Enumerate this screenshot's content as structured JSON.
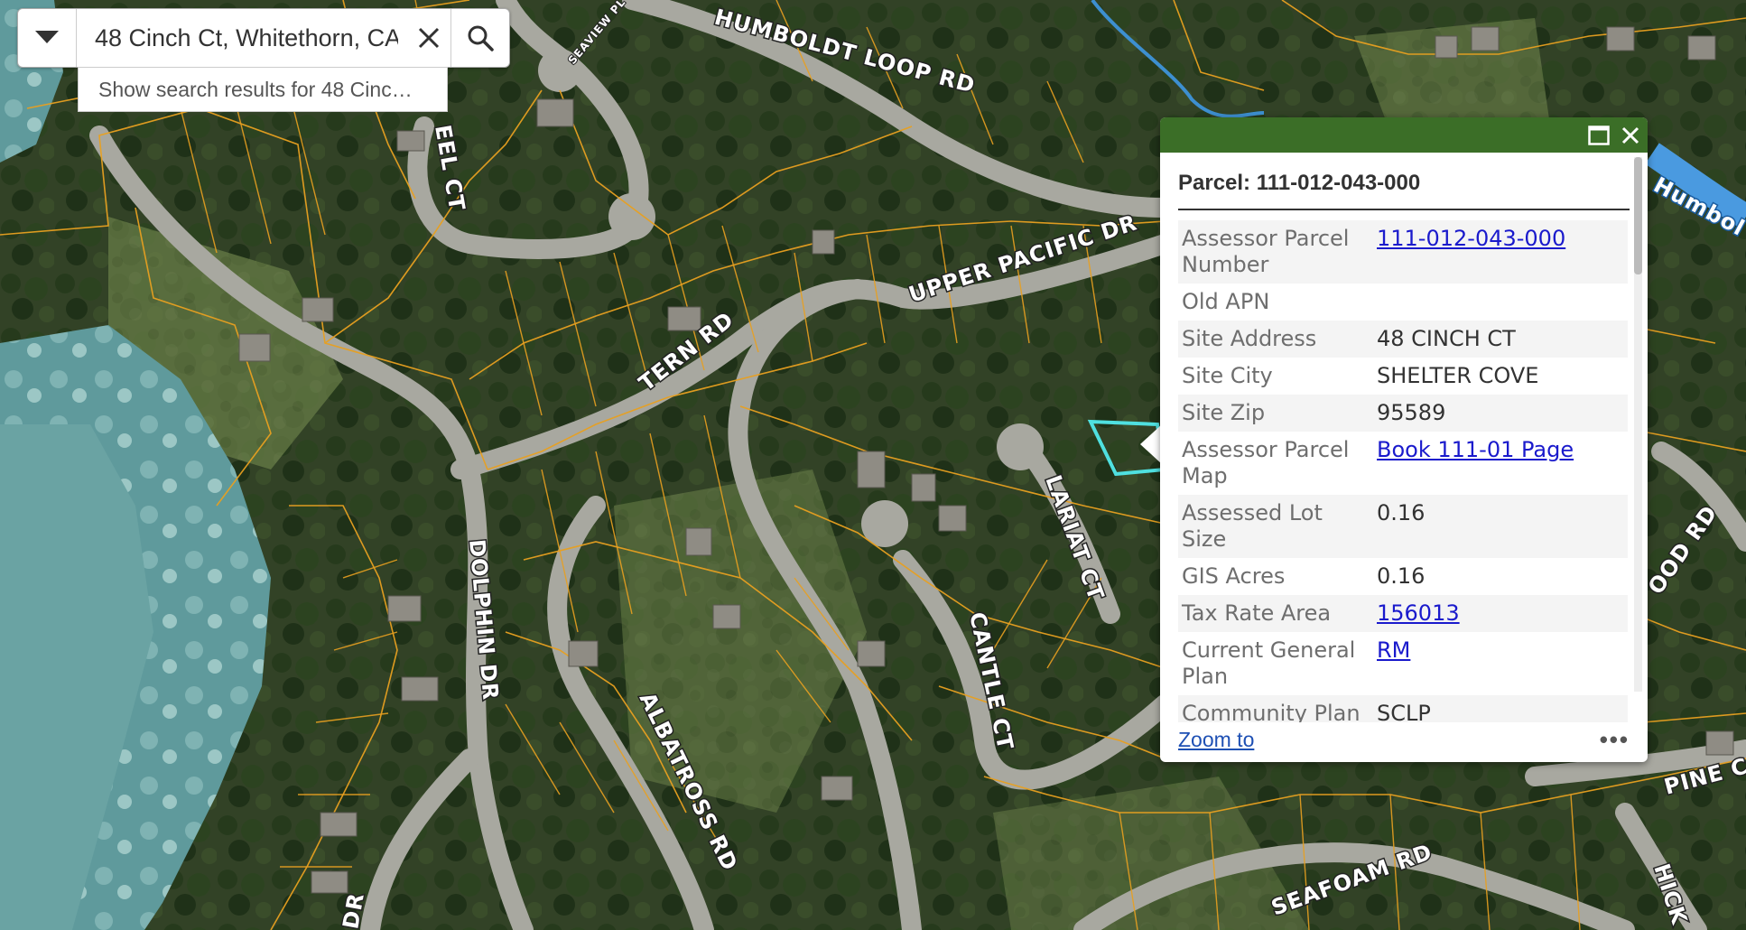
{
  "search": {
    "value": "48 Cinch Ct, Whitethorn, CA",
    "suggestion": "Show search results for 48 Cinc…"
  },
  "map": {
    "road_labels": [
      "HUMBOLDT LOOP RD",
      "UPPER PACIFIC DR",
      "TERN RD",
      "DOLPHIN DR",
      "ALBATROSS RD",
      "CANTLE CT",
      "LARIAT CT",
      "SEAFOAM RD",
      "EEL CT",
      "SEAVIEW PL",
      "OOD RD",
      "PINE C",
      "HICK",
      "DR",
      "Humbol"
    ],
    "colors": {
      "parcel_line": "#e8a020",
      "selected_parcel": "#4fe0e0",
      "road": "#a8a8a0",
      "water": "#6a9ea0"
    }
  },
  "popup": {
    "header_color": "#3b6e27",
    "title": "Parcel: 111-012-043-000",
    "attributes": [
      {
        "key": "Assessor Parcel Number",
        "value": "111-012-043-000",
        "link": true
      },
      {
        "key": "Old APN",
        "value": "",
        "link": false
      },
      {
        "key": "Site Address",
        "value": "48 CINCH CT",
        "link": false
      },
      {
        "key": "Site City",
        "value": "SHELTER COVE",
        "link": false
      },
      {
        "key": "Site Zip",
        "value": "95589",
        "link": false
      },
      {
        "key": "Assessor Parcel Map",
        "value": "Book 111-01 Page",
        "link": true
      },
      {
        "key": "Assessed Lot Size",
        "value": "0.16",
        "link": false
      },
      {
        "key": "GIS Acres",
        "value": "0.16",
        "link": false
      },
      {
        "key": "Tax Rate Area",
        "value": "156013",
        "link": true
      },
      {
        "key": "Current General Plan",
        "value": "RM",
        "link": true
      },
      {
        "key": "Community Plan",
        "value": "SCLP",
        "link": false
      }
    ],
    "zoom_to_label": "Zoom to",
    "more_label": "•••",
    "maximize_icon": "maximize-icon",
    "close_icon": "close-icon"
  }
}
